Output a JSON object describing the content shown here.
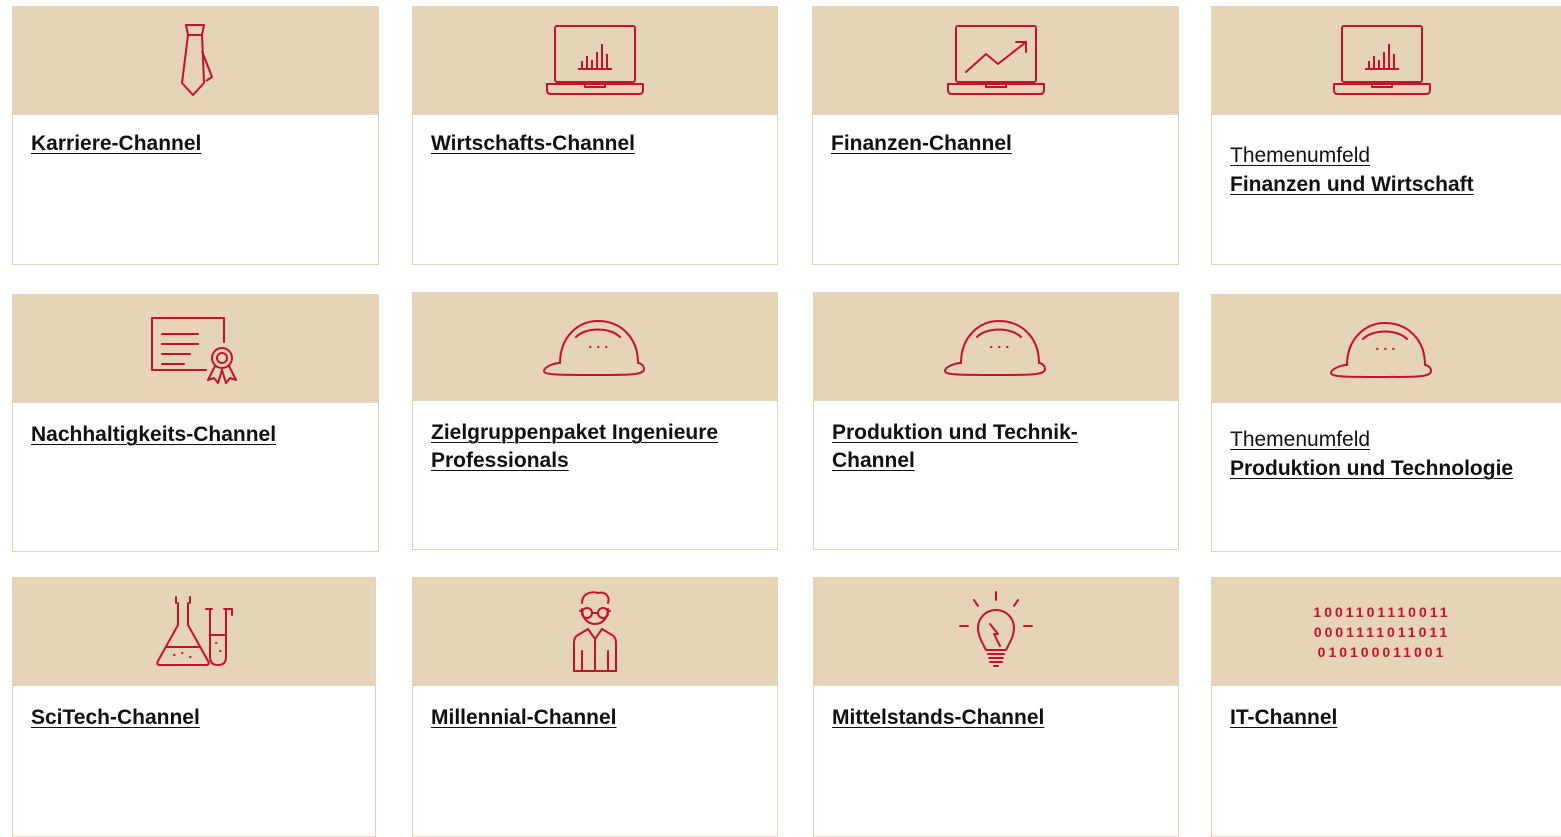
{
  "theme": {
    "accent": "#c8102e",
    "band": "#e5d4b5",
    "border": "#e0d3b8",
    "text": "#111111"
  },
  "cards": [
    {
      "icon": "necktie-icon",
      "title": "Karriere-Channel"
    },
    {
      "icon": "laptop-bar-chart-icon",
      "title": "Wirtschafts-Channel"
    },
    {
      "icon": "laptop-trend-chart-icon",
      "title": "Finanzen-Channel"
    },
    {
      "icon": "laptop-bar-chart-icon",
      "topic": "Themenumfeld",
      "title": "Finanzen und Wirtschaft"
    },
    {
      "icon": "certificate-icon",
      "title": "Nachhaltigkeits-Channel"
    },
    {
      "icon": "hard-hat-icon",
      "title_lines": [
        "Zielgruppenpaket Ingenieure",
        "Professionals"
      ]
    },
    {
      "icon": "hard-hat-icon",
      "title_lines": [
        "Produktion und Technik-",
        "Channel"
      ]
    },
    {
      "icon": "hard-hat-icon",
      "topic": "Themenumfeld",
      "title": "Produktion und Technologie"
    },
    {
      "icon": "lab-flask-icon",
      "title": "SciTech-Channel"
    },
    {
      "icon": "person-glasses-icon",
      "title": "Millennial-Channel"
    },
    {
      "icon": "lightbulb-icon",
      "title": "Mittelstands-Channel"
    },
    {
      "icon": "binary-code-icon",
      "binary": [
        "1001101110011",
        "0001111011011",
        "010100011001"
      ],
      "title": "IT-Channel"
    }
  ]
}
